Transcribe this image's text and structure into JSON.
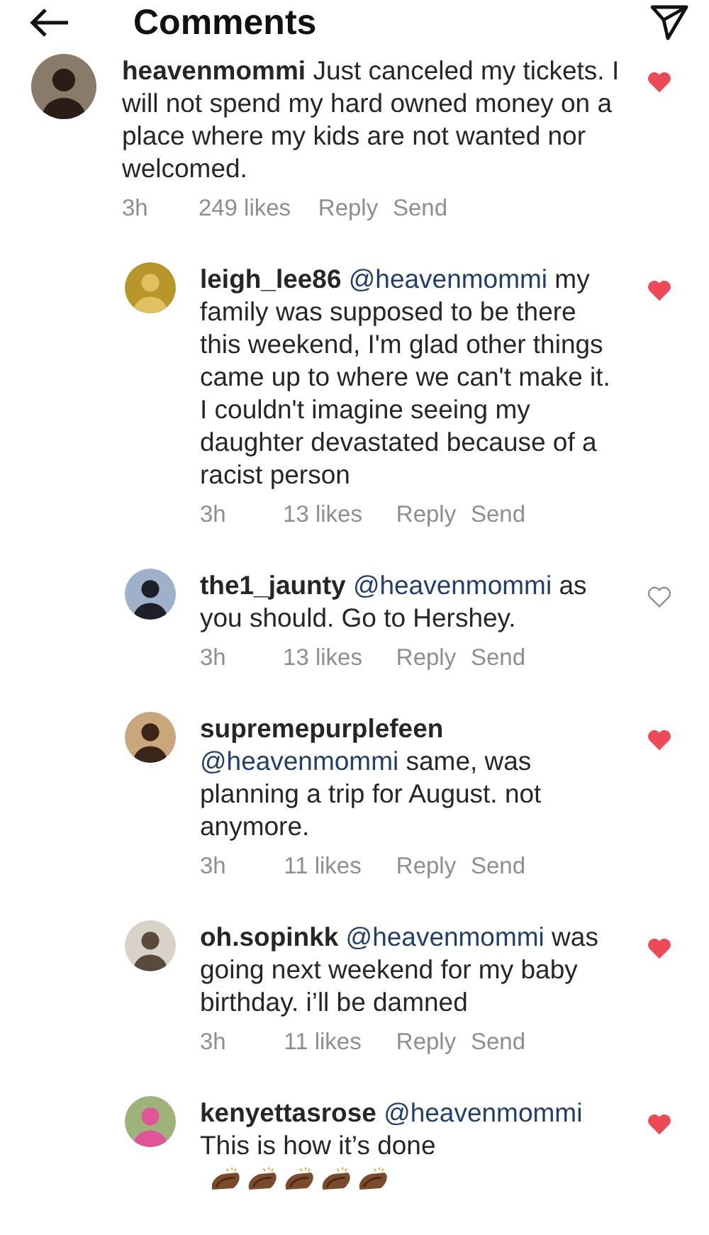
{
  "header": {
    "title": "Comments"
  },
  "comments": [
    {
      "username": "heavenmommi",
      "text": "Just canceled my tickets. I will not spend my hard owned money on a place where my kids are not wanted nor welcomed.",
      "time": "3h",
      "likes": "249 likes",
      "reply": "Reply",
      "send": "Send",
      "liked": true,
      "children": [
        {
          "username": "leigh_lee86",
          "mention": "@heavenmommi",
          "text": "my family was supposed to be there this weekend, I'm glad other things came up to where we can't make it. I couldn't imagine seeing my daughter devastated because of a racist person",
          "time": "3h",
          "likes": "13 likes",
          "reply": "Reply",
          "send": "Send",
          "liked": true
        },
        {
          "username": "the1_jaunty",
          "mention": "@heavenmommi",
          "text": "as you should.  Go to Hershey.",
          "time": "3h",
          "likes": "13 likes",
          "reply": "Reply",
          "send": "Send",
          "liked": false
        },
        {
          "username": "supremepurplefeen",
          "mention": "@heavenmommi",
          "text": "same, was planning a trip  for August. not anymore.",
          "time": "3h",
          "likes": "11 likes",
          "reply": "Reply",
          "send": "Send",
          "liked": true
        },
        {
          "username": "oh.sopinkk",
          "mention": "@heavenmommi",
          "text": "was going next weekend for my baby birthday. i’ll be damned",
          "time": "3h",
          "likes": "11 likes",
          "reply": "Reply",
          "send": "Send",
          "liked": true
        },
        {
          "username": "kenyettasrose",
          "mention": "@heavenmommi",
          "text": "This is how it’s done",
          "liked": true
        }
      ]
    }
  ]
}
